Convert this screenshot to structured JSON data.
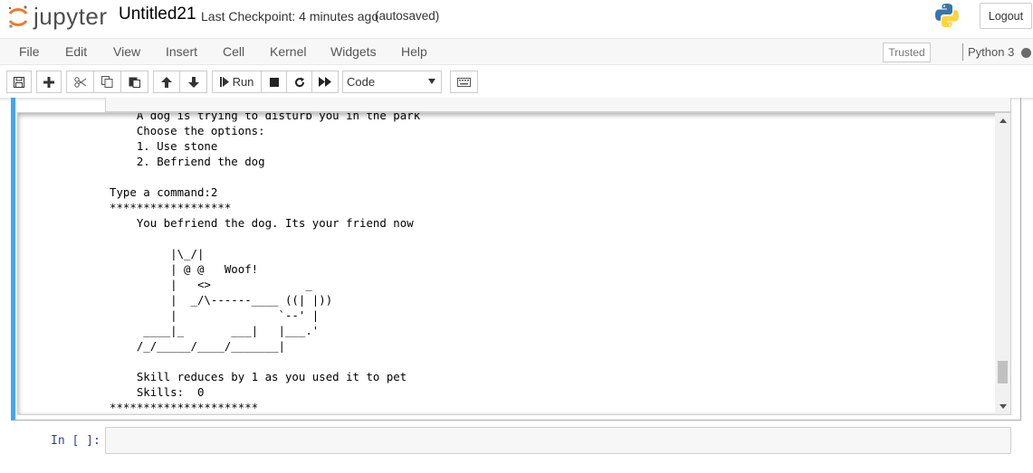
{
  "header": {
    "logo_text": "jupyter",
    "notebook_name": "Untitled21",
    "checkpoint": "Last Checkpoint: 4 minutes ago",
    "autosave_status": "(autosaved)",
    "logout_label": "Logout"
  },
  "menubar": {
    "items": [
      "File",
      "Edit",
      "View",
      "Insert",
      "Cell",
      "Kernel",
      "Widgets",
      "Help"
    ],
    "trusted_label": "Trusted",
    "kernel_name": "Python 3"
  },
  "toolbar": {
    "run_label": "Run",
    "cell_type": "Code"
  },
  "output": {
    "lines": [
      "    A dog is trying to disturb you in the park",
      "    Choose the options:",
      "    1. Use stone",
      "    2. Befriend the dog",
      "",
      "Type a command:2",
      "******************",
      "    You befriend the dog. Its your friend now",
      "",
      "         |\\_/|",
      "         | @ @   Woof!",
      "         |   <>              _",
      "         |  _/\\------____ ((| |))",
      "         |               `--' |",
      "     ____|_       ___|   |___.'",
      "    /_/_____/____/_______|",
      "",
      "    Skill reduces by 1 as you used it to pet",
      "    Skills:  0",
      "**********************"
    ]
  },
  "next_cell": {
    "prompt": "In [ ]:"
  }
}
